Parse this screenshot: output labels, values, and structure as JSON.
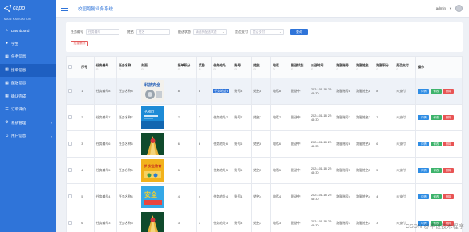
{
  "sidebar": {
    "logo_text": "capo",
    "caption": "MAIN NAVIGATION",
    "items": [
      {
        "label": "Dashboard",
        "icon": "home-icon",
        "glyph": "⌂"
      },
      {
        "label": "学生",
        "icon": "user-icon",
        "glyph": "●"
      },
      {
        "label": "任务信息",
        "icon": "grid-icon",
        "glyph": "▦"
      },
      {
        "label": "接单信息",
        "icon": "grid-icon",
        "glyph": "▦"
      },
      {
        "label": "配送信息",
        "icon": "grid-icon",
        "glyph": "▦"
      },
      {
        "label": "确认完成",
        "icon": "grid-icon",
        "glyph": "▦"
      },
      {
        "label": "订单评价",
        "icon": "list-icon",
        "glyph": "☰"
      },
      {
        "label": "系统管理",
        "icon": "gear-icon",
        "glyph": "⚙"
      },
      {
        "label": "用户信息",
        "icon": "people-icon",
        "glyph": "☺"
      }
    ]
  },
  "header": {
    "title": "校园跑腿业务系统",
    "user": "admin"
  },
  "search": {
    "label1": "任务编号",
    "placeholder1": "任务编号",
    "label2": "姓名",
    "placeholder2": "姓名",
    "label3": "配送状态",
    "placeholder3": "请选择配送状态",
    "label4": "是否支付",
    "placeholder4": "是否支付",
    "search_button": "查询",
    "delete_button": "批量删除"
  },
  "table": {
    "headers": [
      {
        "label": "",
        "sort": ""
      },
      {
        "label": "序号",
        "sort": ""
      },
      {
        "label": "任务编号",
        "sort": "◇"
      },
      {
        "label": "任务名称",
        "sort": "◇"
      },
      {
        "label": "封面",
        "sort": "◇"
      },
      {
        "label": "接单积分",
        "sort": "◇"
      },
      {
        "label": "奖励",
        "sort": "◇"
      },
      {
        "label": "任务地址",
        "sort": "◇"
      },
      {
        "label": "账号",
        "sort": "◇"
      },
      {
        "label": "姓名",
        "sort": "◇"
      },
      {
        "label": "电话",
        "sort": "◇"
      },
      {
        "label": "配送状态",
        "sort": "◇"
      },
      {
        "label": "派送时间",
        "sort": "◇"
      },
      {
        "label": "跑腿账号",
        "sort": "◇"
      },
      {
        "label": "跑腿姓名",
        "sort": "◇"
      },
      {
        "label": "跑腿积分",
        "sort": "◇"
      },
      {
        "label": "是否支付",
        "sort": "◇"
      },
      {
        "label": "操作",
        "sort": ""
      }
    ],
    "rows": [
      {
        "idx": "1",
        "code": "任务编号8",
        "name": "任务名称8",
        "cover": "cover-tech",
        "points": "8",
        "reward": "8",
        "addr": "任务地址8",
        "acct": "账号8",
        "uname": "姓名8",
        "phone": "电话8",
        "status": "配送中",
        "time": "2024-04-18 22:48:30",
        "racct": "跑腿账号8",
        "rname": "跑腿姓名8",
        "rpoints": "8",
        "paid": "未支付",
        "highlight": true
      },
      {
        "idx": "2",
        "code": "任务编号7",
        "name": "任务名称7",
        "cover": "cover-blue",
        "points": "7",
        "reward": "7",
        "addr": "任务地址7",
        "acct": "账号7",
        "uname": "姓名7",
        "phone": "电话7",
        "status": "配送中",
        "time": "2024-04-18 22:48:30",
        "racct": "跑腿账号7",
        "rname": "跑腿姓名7",
        "rpoints": "7",
        "paid": "未支付",
        "highlight": false
      },
      {
        "idx": "3",
        "code": "任务编号6",
        "name": "任务名称6",
        "cover": "cover-road",
        "points": "6",
        "reward": "6",
        "addr": "任务地址6",
        "acct": "账号6",
        "uname": "姓名6",
        "phone": "电话6",
        "status": "配送中",
        "time": "2024-04-18 22:48:30",
        "racct": "跑腿账号6",
        "rname": "跑腿姓名6",
        "rpoints": "6",
        "paid": "未支付",
        "highlight": false
      },
      {
        "idx": "4",
        "code": "任务编号5",
        "name": "任务名称5",
        "cover": "cover-yellow",
        "points": "5",
        "reward": "5",
        "addr": "任务地址5",
        "acct": "账号5",
        "uname": "姓名5",
        "phone": "电话5",
        "status": "配送中",
        "time": "2024-04-18 22:48:30",
        "racct": "跑腿账号5",
        "rname": "跑腿姓名5",
        "rpoints": "5",
        "paid": "未支付",
        "highlight": false
      },
      {
        "idx": "5",
        "code": "任务编号4",
        "name": "任务名称4",
        "cover": "cover-safety",
        "points": "4",
        "reward": "4",
        "addr": "任务地址4",
        "acct": "账号4",
        "uname": "姓名4",
        "phone": "电话4",
        "status": "配送中",
        "time": "2024-04-18 22:48:30",
        "racct": "跑腿账号4",
        "rname": "跑腿姓名4",
        "rpoints": "4",
        "paid": "未支付",
        "highlight": false
      },
      {
        "idx": "6",
        "code": "任务编号3",
        "name": "任务名称3",
        "cover": "cover-road",
        "points": "3",
        "reward": "3",
        "addr": "任务地址3",
        "acct": "账号3",
        "uname": "姓名3",
        "phone": "电话3",
        "status": "配送中",
        "time": "2024-04-18 22:48:30",
        "racct": "跑腿账号3",
        "rname": "跑腿姓名3",
        "rpoints": "3",
        "paid": "未支付",
        "highlight": false
      }
    ],
    "op_detail": "详情",
    "op_edit": "修改",
    "op_delete": "删除"
  },
  "cover_texts": {
    "tech": "科技安全",
    "blue": "FAMILY",
    "yellow": "学 安全教育",
    "safety": "安全"
  },
  "watermark": "CSDN @毕设技术程序",
  "colors": {
    "sidebar": "#2f74d9",
    "primary": "#2f74d9",
    "danger": "#e85454",
    "success": "#3db36b"
  }
}
